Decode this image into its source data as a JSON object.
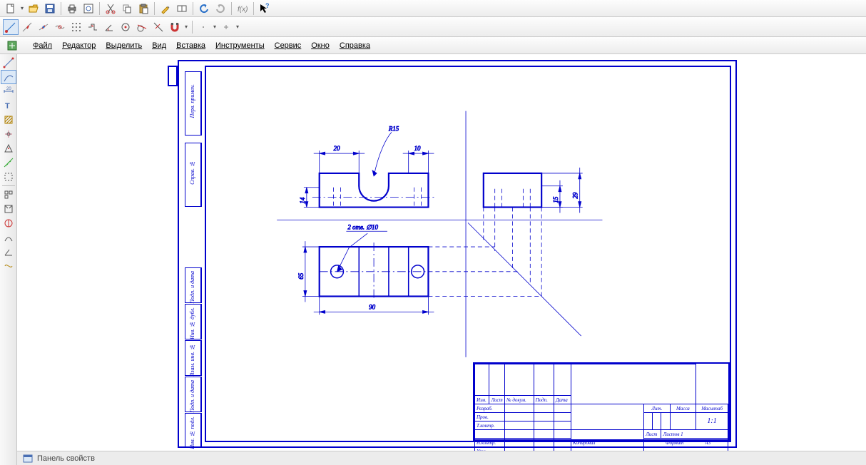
{
  "menus": {
    "file": "Файл",
    "editor": "Редактор",
    "select": "Выделить",
    "view": "Вид",
    "insert": "Вставка",
    "tools": "Инструменты",
    "service": "Сервис",
    "window": "Окно",
    "help": "Справка"
  },
  "status": {
    "panel": "Панель свойств"
  },
  "drawing": {
    "dims": {
      "r15": "R15",
      "d20": "20",
      "d10": "10",
      "d14": "14",
      "d15": "15",
      "d29": "29",
      "d65": "65",
      "d90": "90",
      "holes": "2 отв. ∅10"
    },
    "titleblock": {
      "izm": "Изм.",
      "list": "Лист",
      "ndok": "№ докум.",
      "podp": "Подп.",
      "data": "Дата",
      "razrab": "Разраб.",
      "prov": "Пров.",
      "tkontr": "Т.контр.",
      "nkontr": "Н.контр.",
      "utv": "Утв.",
      "lit": "Лит.",
      "massa": "Масса",
      "masshtab": "Масштаб",
      "scale": "1:1",
      "list2": "Лист",
      "listov": "Листов  1",
      "kopiroval": "Копировал",
      "format": "Формат",
      "formatval": "А3"
    },
    "margins": {
      "perv_primen": "Перв. примен.",
      "sprav_no": "Справ. №",
      "podp_data": "Подп. и дата",
      "inv_dubl": "Инв. № дубл.",
      "vzam_inv": "Взам. инв. №",
      "podp_data2": "Подп. и дата",
      "inv_podl": "Инв. № подл."
    }
  }
}
